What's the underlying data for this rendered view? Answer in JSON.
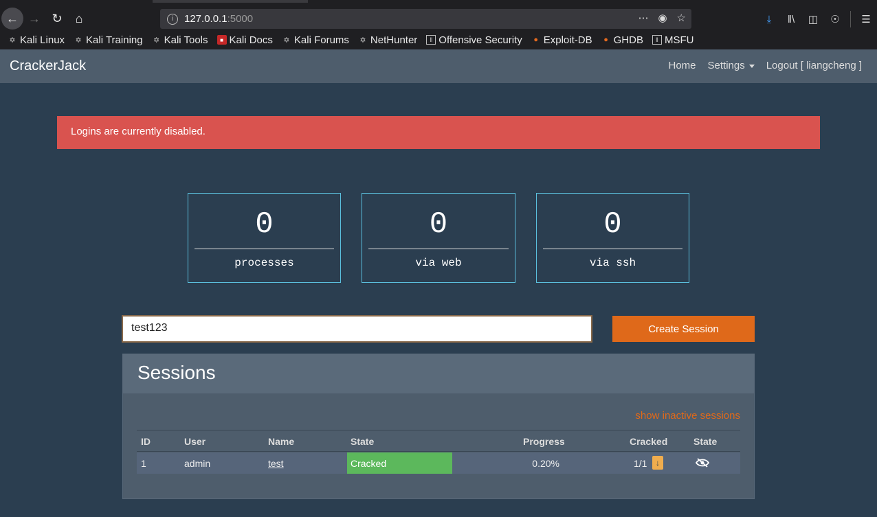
{
  "browser": {
    "url_host": "127.0.0.1",
    "url_port": ":5000",
    "bookmarks": [
      {
        "label": "Kali Linux",
        "icon": "kali-dragon-icon"
      },
      {
        "label": "Kali Training",
        "icon": "kali-dragon-icon"
      },
      {
        "label": "Kali Tools",
        "icon": "kali-dragon-icon"
      },
      {
        "label": "Kali Docs",
        "icon": "kali-docs-icon"
      },
      {
        "label": "Kali Forums",
        "icon": "kali-dragon-icon"
      },
      {
        "label": "NetHunter",
        "icon": "nethunter-icon"
      },
      {
        "label": "Offensive Security",
        "icon": "offsec-icon"
      },
      {
        "label": "Exploit-DB",
        "icon": "exploitdb-icon"
      },
      {
        "label": "GHDB",
        "icon": "exploitdb-icon"
      },
      {
        "label": "MSFU",
        "icon": "offsec-icon"
      }
    ]
  },
  "navbar": {
    "brand": "CrackerJack",
    "home": "Home",
    "settings": "Settings",
    "logout": "Logout [ liangcheng ]"
  },
  "alert": {
    "message": "Logins are currently disabled."
  },
  "stats": [
    {
      "value": "0",
      "label": "processes"
    },
    {
      "value": "0",
      "label": "via web"
    },
    {
      "value": "0",
      "label": "via ssh"
    }
  ],
  "form": {
    "session_name_value": "test123",
    "create_button": "Create Session"
  },
  "sessions": {
    "title": "Sessions",
    "show_inactive": "show inactive sessions",
    "columns": [
      "ID",
      "User",
      "Name",
      "State",
      "Progress",
      "Cracked",
      "State"
    ],
    "rows": [
      {
        "id": "1",
        "user": "admin",
        "name": "test",
        "state": "Cracked",
        "progress": "0.20%",
        "cracked": "1/1"
      }
    ]
  },
  "colors": {
    "background": "#2b3e50",
    "navbar": "#4e5d6c",
    "alert": "#d9534f",
    "accent": "#df691a",
    "stat_border": "#5bc0de",
    "cracked": "#5cb85c"
  }
}
